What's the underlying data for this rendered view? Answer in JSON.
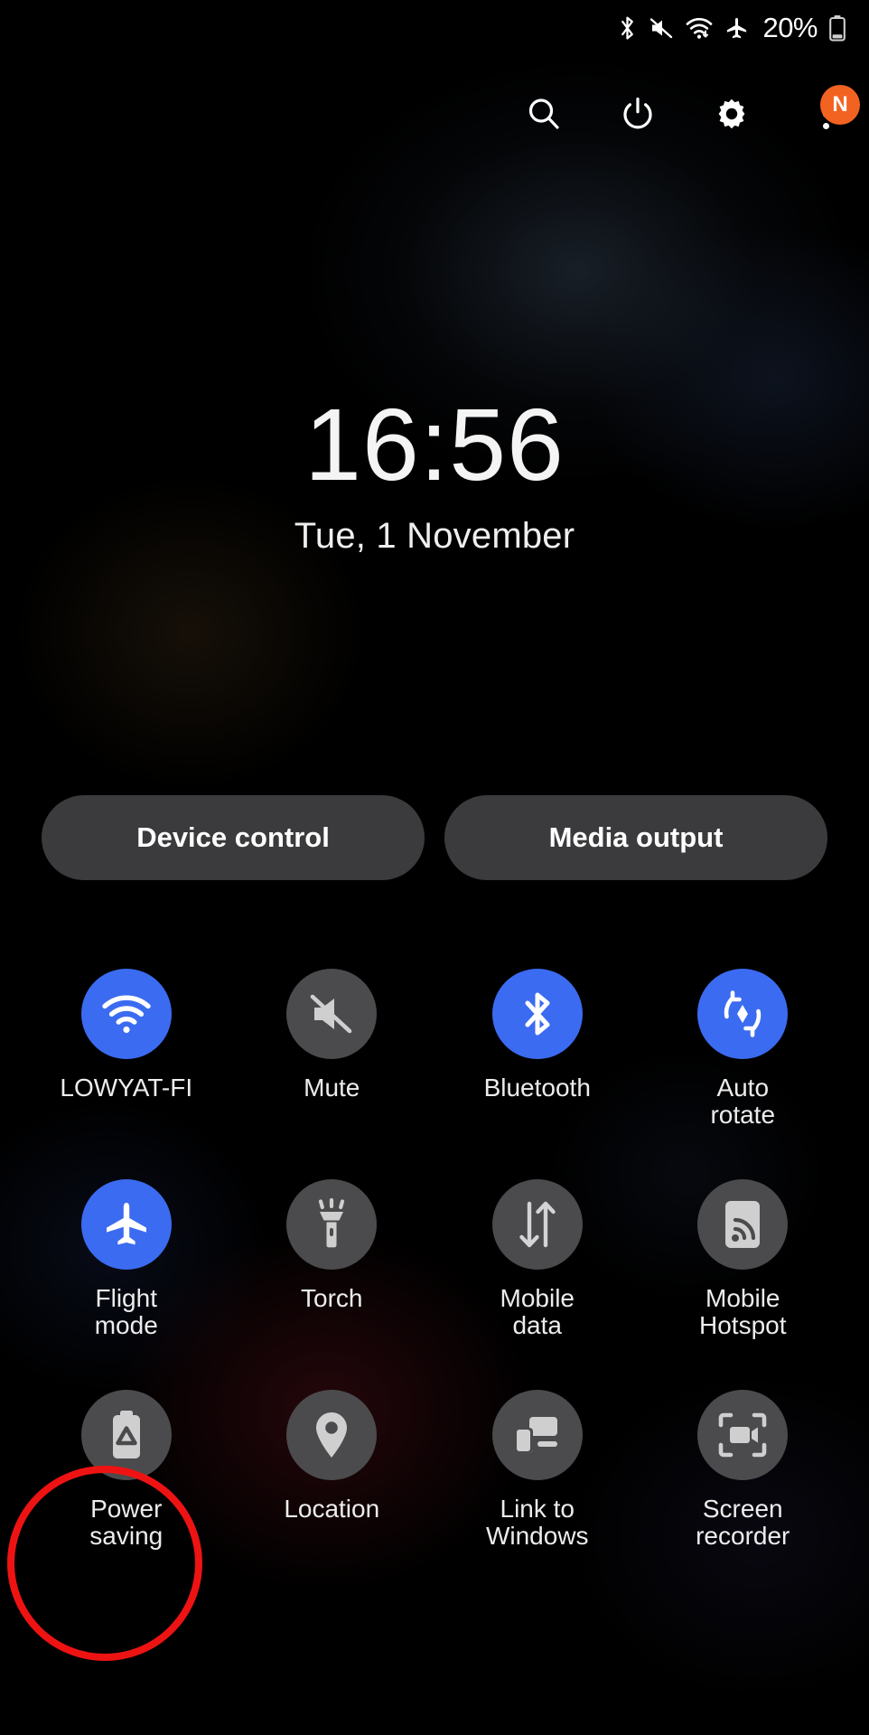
{
  "status_bar": {
    "icons": [
      "bluetooth-icon",
      "mute-icon",
      "wifi-icon",
      "airplane-icon"
    ],
    "battery_percent": "20%",
    "battery_icon": "battery-low-icon"
  },
  "panel_header": {
    "buttons": [
      {
        "name": "search-icon",
        "label": "Search"
      },
      {
        "name": "power-icon",
        "label": "Power"
      },
      {
        "name": "gear-icon",
        "label": "Settings"
      },
      {
        "name": "more-options-icon",
        "label": "More options"
      }
    ],
    "notification_badge": "N"
  },
  "clock": {
    "time": "16:56",
    "date": "Tue, 1 November"
  },
  "pills": [
    {
      "label": "Device control"
    },
    {
      "label": "Media output"
    }
  ],
  "toggles": [
    {
      "label": "LOWYAT-FI",
      "icon": "wifi-icon",
      "state": "on"
    },
    {
      "label": "Mute",
      "icon": "mute-icon",
      "state": "off"
    },
    {
      "label": "Bluetooth",
      "icon": "bluetooth-icon",
      "state": "on"
    },
    {
      "label": "Auto\nrotate",
      "icon": "auto-rotate-icon",
      "state": "on"
    },
    {
      "label": "Flight\nmode",
      "icon": "airplane-icon",
      "state": "on"
    },
    {
      "label": "Torch",
      "icon": "torch-icon",
      "state": "off"
    },
    {
      "label": "Mobile\ndata",
      "icon": "mobile-data-icon",
      "state": "off"
    },
    {
      "label": "Mobile\nHotspot",
      "icon": "hotspot-icon",
      "state": "off"
    },
    {
      "label": "Power\nsaving",
      "icon": "power-saving-icon",
      "state": "off"
    },
    {
      "label": "Location",
      "icon": "location-pin-icon",
      "state": "off"
    },
    {
      "label": "Link to\nWindows",
      "icon": "link-to-windows-icon",
      "state": "off"
    },
    {
      "label": "Screen\nrecorder",
      "icon": "screen-recorder-icon",
      "state": "off"
    }
  ],
  "annotation": {
    "target": "Power saving",
    "color": "#ee1313",
    "shape": "circle"
  },
  "colors": {
    "accent_on": "#3b6bf0",
    "tile_off": "#4b4b4d",
    "pill_bg": "#48484a",
    "badge": "#f26322",
    "annotation": "#ee1313",
    "background": "#000000"
  }
}
